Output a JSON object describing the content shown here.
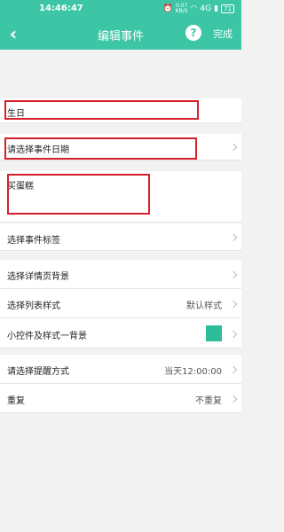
{
  "status_bar": {
    "time": "14:46:47",
    "speed_value": "0.07",
    "speed_unit": "KB/S",
    "network": "4G",
    "battery": "71"
  },
  "header": {
    "title": "编辑事件",
    "done_label": "完成",
    "help_symbol": "?"
  },
  "form": {
    "event_name": "生日",
    "date_placeholder": "请选择事件日期",
    "note": "买蛋糕"
  },
  "settings": {
    "tag_label": "选择事件标签",
    "detail_bg_label": "选择详情页背景",
    "list_style_label": "选择列表样式",
    "list_style_value": "默认样式",
    "widget_label": "小控件及样式一背景",
    "widget_color": "#2ebd9a",
    "reminder_label": "请选择提醒方式",
    "reminder_value": "当天12:00:00",
    "repeat_label": "重复",
    "repeat_value": "不重复"
  },
  "colors": {
    "brand": "#3cc6a5",
    "highlight": "#d8202a"
  }
}
